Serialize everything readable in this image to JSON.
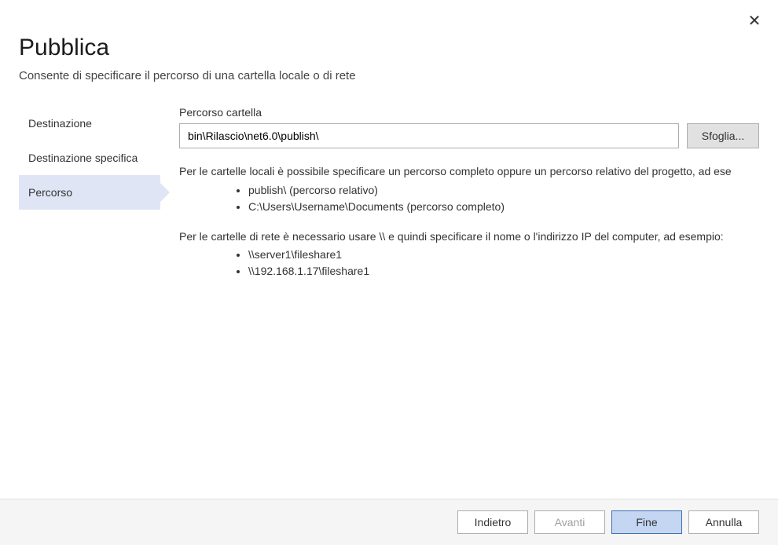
{
  "header": {
    "title": "Pubblica",
    "subtitle": "Consente di specificare il percorso di una cartella locale o di rete"
  },
  "sidebar": {
    "items": [
      {
        "label": "Destinazione",
        "active": false
      },
      {
        "label": "Destinazione specifica",
        "active": false
      },
      {
        "label": "Percorso",
        "active": true
      }
    ]
  },
  "main": {
    "field_label": "Percorso cartella",
    "input_value": "bin\\Rilascio\\net6.0\\publish\\",
    "browse_label": "Sfoglia...",
    "help": {
      "local_intro": "Per le cartelle locali è possibile specificare un percorso completo oppure un percorso relativo del progetto, ad ese",
      "local_examples": [
        "publish\\ (percorso relativo)",
        "C:\\Users\\Username\\Documents (percorso completo)"
      ],
      "network_intro": "Per le cartelle di rete è necessario usare \\\\ e quindi specificare il nome o l'indirizzo IP del computer, ad esempio:",
      "network_examples": [
        "\\\\server1\\fileshare1",
        "\\\\192.168.1.17\\fileshare1"
      ]
    }
  },
  "footer": {
    "back": "Indietro",
    "next": "Avanti",
    "finish": "Fine",
    "cancel": "Annulla"
  }
}
